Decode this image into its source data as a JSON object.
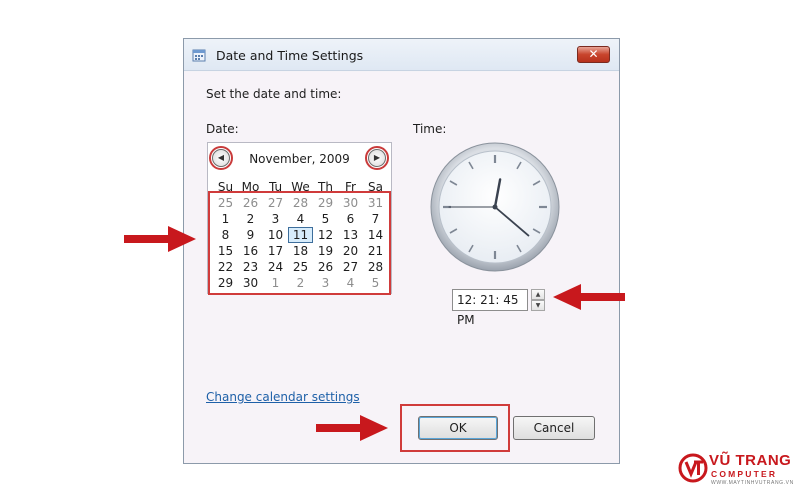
{
  "window": {
    "title": "Date and Time Settings",
    "close_label": "✕"
  },
  "heading": "Set the date and time:",
  "date_label": "Date:",
  "time_label": "Time:",
  "calendar": {
    "month_label": "November, 2009",
    "weekdays": [
      "Su",
      "Mo",
      "Tu",
      "We",
      "Th",
      "Fr",
      "Sa"
    ],
    "weeks": [
      [
        "25",
        "26",
        "27",
        "28",
        "29",
        "30",
        "31"
      ],
      [
        "1",
        "2",
        "3",
        "4",
        "5",
        "6",
        "7"
      ],
      [
        "8",
        "9",
        "10",
        "11",
        "12",
        "13",
        "14"
      ],
      [
        "15",
        "16",
        "17",
        "18",
        "19",
        "20",
        "21"
      ],
      [
        "22",
        "23",
        "24",
        "25",
        "26",
        "27",
        "28"
      ],
      [
        "29",
        "30",
        "1",
        "2",
        "3",
        "4",
        "5"
      ]
    ],
    "selected_day": "11"
  },
  "clock": {
    "hour": 12,
    "minute": 21,
    "second": 45
  },
  "time_value": "12: 21: 45 PM",
  "change_calendar_link": "Change calendar settings",
  "buttons": {
    "ok": "OK",
    "cancel": "Cancel"
  },
  "annotation_color": "#c8181d",
  "logo": {
    "name": "VŨ TRANG",
    "sub": "COMPUTER",
    "url": "WWW.MAYTINHVUTRANG.VN"
  }
}
